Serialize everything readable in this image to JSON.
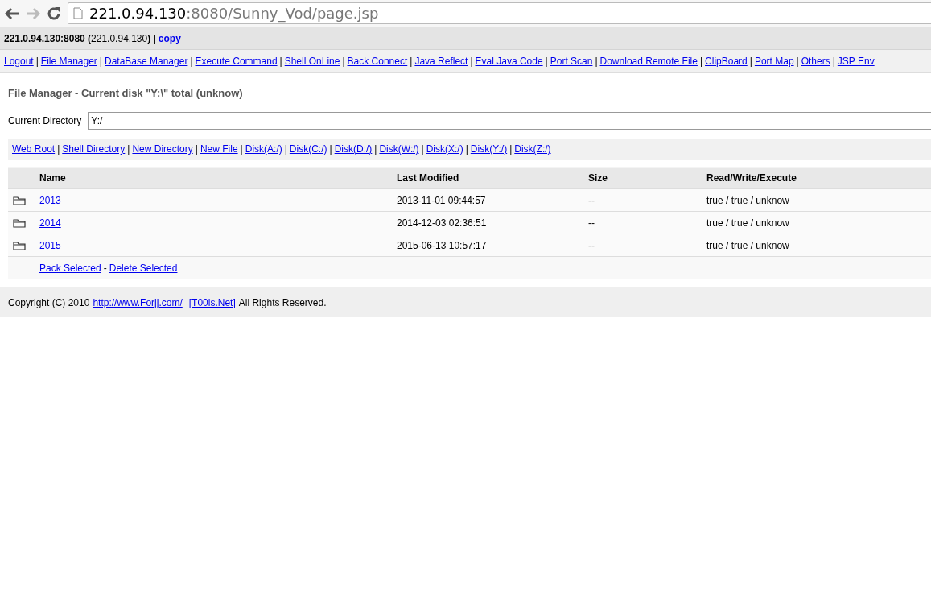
{
  "browser": {
    "url_host": "221.0.94.130",
    "url_rest": ":8080/Sunny_Vod/page.jsp",
    "forward_disabled": true
  },
  "host_bar": {
    "text": "**221.0.94.130:8080 (**221.0.94.130**) |**",
    "copy_link": "copy"
  },
  "nav": {
    "separator": "|",
    "links": [
      "Logout",
      "File Manager",
      "DataBase Manager",
      "Execute Command",
      "Shell OnLine",
      "Back Connect",
      "Java Reflect",
      "Eval Java Code",
      "Port Scan",
      "Download Remote File",
      "ClipBoard",
      "Port Map",
      "Others",
      "JSP Env"
    ]
  },
  "title": "File Manager - Current disk \"Y:\\\" total (unknow)",
  "directory": {
    "label": "Current Directory",
    "value": "Y:/"
  },
  "shortcuts": {
    "separator": "|",
    "links": [
      "Web Root",
      "Shell Directory",
      "New Directory",
      "New File",
      "Disk(A:/)",
      "Disk(C:/)",
      "Disk(D:/)",
      "Disk(W:/)",
      "Disk(X:/)",
      "Disk(Y:/)",
      "Disk(Z:/)"
    ]
  },
  "table": {
    "columns": [
      "Name",
      "Last Modified",
      "Size",
      "Read/Write/Execute"
    ],
    "rows": [
      {
        "kind": "folder",
        "name": "2013",
        "modified": "2013-11-01 09:44:57",
        "size": "--",
        "permissions": "true / true / unknow"
      },
      {
        "kind": "folder",
        "name": "2014",
        "modified": "2014-12-03 02:36:51",
        "size": "--",
        "permissions": "true / true / unknow"
      },
      {
        "kind": "folder",
        "name": "2015",
        "modified": "2015-06-13 10:57:17",
        "size": "--",
        "permissions": "true / true / unknow"
      }
    ],
    "actions": {
      "pack": "Pack Selected",
      "separator": "-",
      "delete": "Delete Selected"
    }
  },
  "footer": {
    "before": "Copyright (C) 2010",
    "link1": "http://www.Forjj.com/",
    "link2": "[T00ls.Net]",
    "after": "All Rights Reserved."
  }
}
